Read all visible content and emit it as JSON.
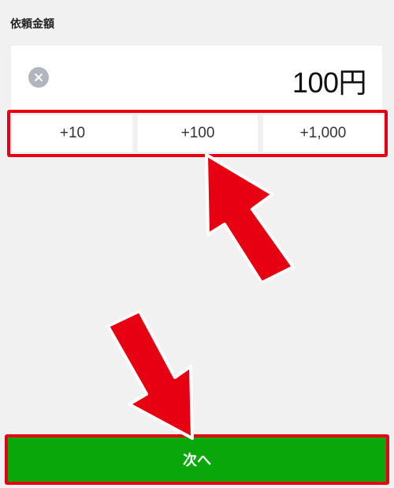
{
  "section": {
    "label": "依頼金額"
  },
  "amount": {
    "value": "100円"
  },
  "increments": [
    "+10",
    "+100",
    "+1,000"
  ],
  "next": {
    "label": "次へ"
  },
  "colors": {
    "accent_red": "#e60012",
    "next_green": "#0aa70a",
    "background": "#f1f1f1",
    "clear_icon_bg": "#b1b6bc"
  },
  "icons": {
    "clear": "close-circle-icon"
  }
}
